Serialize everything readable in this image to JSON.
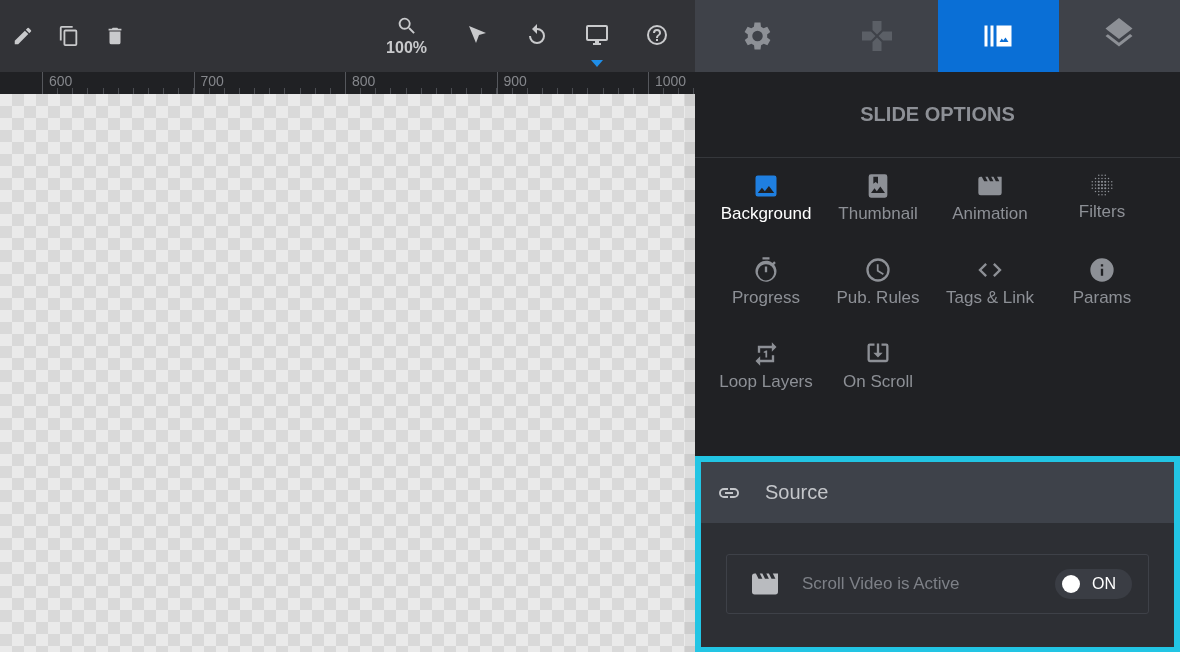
{
  "toolbar": {
    "left_tools": [
      {
        "kind": "pencil"
      },
      {
        "kind": "copy"
      },
      {
        "kind": "trash"
      }
    ],
    "zoom": {
      "label": "100%"
    },
    "right_tools": [
      {
        "kind": "cursor",
        "selected": false
      },
      {
        "kind": "undo",
        "selected": false
      },
      {
        "kind": "monitor",
        "selected": true
      },
      {
        "kind": "help",
        "selected": false
      }
    ]
  },
  "ruler": {
    "labels": [
      "600",
      "700",
      "800",
      "900",
      "1000"
    ]
  },
  "panel_tabs": [
    {
      "kind": "gear",
      "selected": false,
      "disabled": false
    },
    {
      "kind": "gamepad",
      "selected": false,
      "disabled": true
    },
    {
      "kind": "slides",
      "selected": true,
      "disabled": false
    },
    {
      "kind": "layers",
      "selected": false,
      "disabled": false
    }
  ],
  "panel": {
    "title": "SLIDE OPTIONS",
    "options": [
      {
        "kind": "image",
        "label": "Background",
        "selected": true
      },
      {
        "kind": "thumbnail",
        "label": "Thumbnail",
        "selected": false
      },
      {
        "kind": "clapper",
        "label": "Animation",
        "selected": false
      },
      {
        "kind": "dots",
        "label": "Filters",
        "selected": false
      },
      {
        "kind": "timer",
        "label": "Progress",
        "selected": false
      },
      {
        "kind": "clock",
        "label": "Pub. Rules",
        "selected": false
      },
      {
        "kind": "code",
        "label": "Tags & Link",
        "selected": false
      },
      {
        "kind": "info",
        "label": "Params",
        "selected": false
      },
      {
        "kind": "repeat",
        "label": "Loop Layers",
        "selected": false
      },
      {
        "kind": "download",
        "label": "On Scroll",
        "selected": false
      }
    ]
  },
  "source": {
    "title": "Source",
    "setting": {
      "label": "Scroll Video is Active",
      "on": true,
      "state_label": "ON"
    }
  }
}
